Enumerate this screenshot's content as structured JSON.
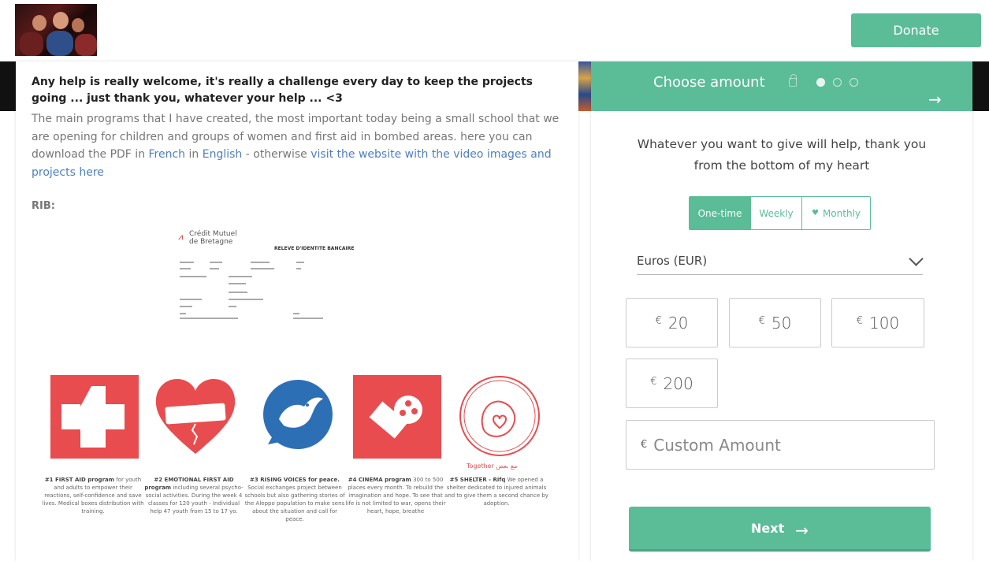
{
  "header": {
    "logo_alt": "",
    "donate_label": "Donate"
  },
  "story": {
    "lead": "Any help is really welcome, it's really a challenge every day to keep the projects going ... just thank you, whatever your help ... <3",
    "desc_part1": "The main programs that I have created, the most important today being a small school that we are opening for children and groups of women and first aid in bombed areas. here you can download the PDF in ",
    "link_french": "French",
    "desc_in": " in ",
    "link_english": "English",
    "desc_part2": " - otherwise ",
    "link_website": "visit the website with the video images and projects here",
    "rib_label": "RIB:",
    "rib": {
      "bank_line1": "Crédit Mutuel",
      "bank_line2": "de Bretagne",
      "title": "RELEVE D'IDENTITE BANCAIRE"
    },
    "programs": [
      {
        "title": "#1 FIRST AID program",
        "text": " for youth and adults to empower their reactions, self-confidence and save lives. Medical boxes distribution with training.",
        "icon": "first-aid-cross-icon",
        "color": "#e84c4f"
      },
      {
        "title": "#2 EMOTIONAL FIRST AID program",
        "text": " including several psycho-social activities. During the week 4 classes for 120 youth - Individual help 47 youth from 15 to 17 yo.",
        "icon": "bandaged-heart-icon",
        "color": "#e84c4f"
      },
      {
        "title": "#3 RISING VOICES for peace.",
        "text": " Social exchanges project between schools but also gathering stories of the Aleppo population to make sens about the situation and call for peace.",
        "icon": "dove-icon",
        "color": "#2d6fb5"
      },
      {
        "title": "#4 CINEMA program",
        "text": " 300 to 500 places every month. To rebuild the imagination and hope. To see that life is not limited to war, opens their heart, hope, breathe",
        "icon": "film-reel-icon",
        "color": "#e84c4f"
      },
      {
        "title": "#5 SHELTER - Rifq",
        "text": " We opened a shelter dedicated to injured animals and to give them a second chance by adoption.",
        "icon": "animal-shelter-icon",
        "color": "#e84c4f",
        "badge": "Together مع بعض"
      }
    ]
  },
  "donation": {
    "title": "Choose amount",
    "step_dots": 3,
    "active_step": 1,
    "thanks": "Whatever you want to give will help, thank you from the bottom of my heart",
    "frequency": {
      "one_time": "One-time",
      "weekly": "Weekly",
      "monthly": "Monthly",
      "selected": "One-time"
    },
    "currency": "Euros (EUR)",
    "currency_symbol": "€",
    "amounts": [
      "20",
      "50",
      "100",
      "200"
    ],
    "custom_placeholder": "Custom Amount",
    "next_label": "Next",
    "accent": "#5bbc98"
  }
}
